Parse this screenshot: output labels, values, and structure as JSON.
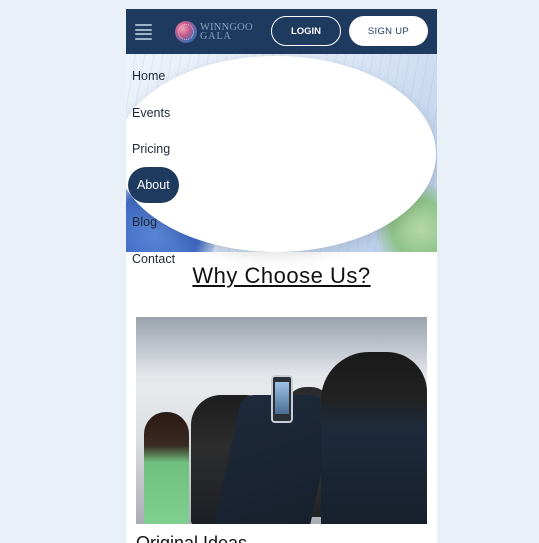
{
  "header": {
    "logo_line1": "WINNGOO",
    "logo_line2": "GALA",
    "login_label": "LOGIN",
    "signup_label": "SIGN UP"
  },
  "menu": {
    "items": [
      {
        "label": "Home"
      },
      {
        "label": "Events"
      },
      {
        "label": "Pricing"
      },
      {
        "label": "About",
        "active": true
      },
      {
        "label": "Blog"
      },
      {
        "label": "Contact"
      }
    ]
  },
  "section": {
    "title": "Why Choose Us?"
  },
  "card": {
    "title": "Original Ideas"
  },
  "colors": {
    "brand": "#1f3a5f",
    "background": "#eaf0f8"
  }
}
